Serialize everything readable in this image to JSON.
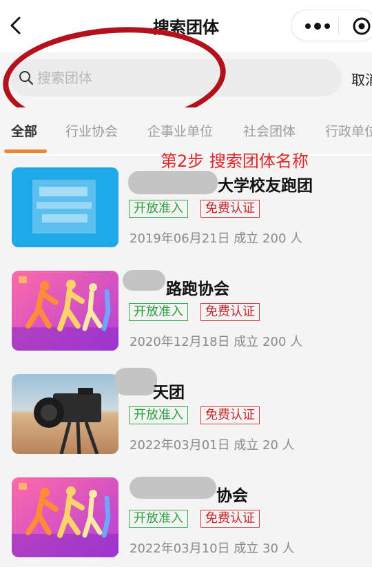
{
  "header": {
    "title": "搜索团体",
    "back_icon": "chevron-left-icon",
    "more_icon": "more-dots-icon",
    "target_icon": "target-circle-icon"
  },
  "search": {
    "placeholder": "搜索团体",
    "value": "",
    "cancel_label": "取消"
  },
  "tabs": [
    {
      "label": "全部",
      "active": true
    },
    {
      "label": "行业协会",
      "active": false
    },
    {
      "label": "企事业单位",
      "active": false
    },
    {
      "label": "社会团体",
      "active": false
    },
    {
      "label": "行政单位",
      "active": false
    }
  ],
  "annotation": {
    "text": "第2步 搜索团体名称",
    "color": "#e32424"
  },
  "colors": {
    "accent": "#f0862f",
    "open_tag": "#2a9d3d",
    "fee_tag": "#c8262c",
    "annotation": "#b3111b"
  },
  "groups": [
    {
      "name": "大学校友跑团",
      "tag_open": "开放准入",
      "tag_fee": "免费认证",
      "meta": "2019年06月21日 成立 200 人",
      "thumb": "blue-logo-image"
    },
    {
      "name": "路跑协会",
      "tag_open": "开放准入",
      "tag_fee": "免费认证",
      "meta": "2020年12月18日 成立 200 人",
      "thumb": "runners-illustration-image"
    },
    {
      "name": "天团",
      "tag_open": "开放准入",
      "tag_fee": "免费认证",
      "meta": "2022年03月01日 成立 20 人",
      "thumb": "camera-desert-photo"
    },
    {
      "name": "协会",
      "tag_open": "开放准入",
      "tag_fee": "免费认证",
      "meta": "2022年03月10日 成立 30 人",
      "thumb": "runners-illustration-image"
    }
  ]
}
